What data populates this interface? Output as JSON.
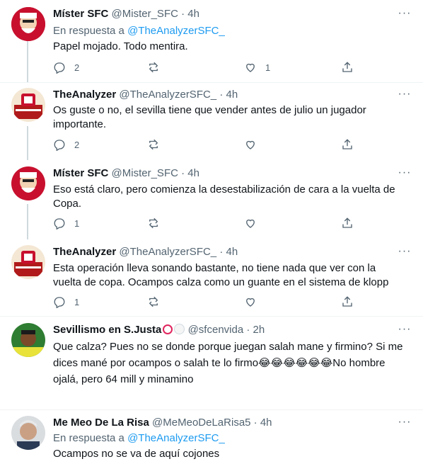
{
  "tweets": [
    {
      "name": "Míster SFC",
      "handle": "@Mister_SFC",
      "time": "4h",
      "reply_prefix": "En respuesta a",
      "reply_to": "@TheAnalyzerSFC_",
      "text": "Papel mojado. Todo mentira.",
      "replies": "2",
      "retweets": "",
      "likes": "1",
      "avatar_color": "#c8102e"
    },
    {
      "name": "TheAnalyzer",
      "handle": "@TheAnalyzerSFC_",
      "time": "4h",
      "text": "Os guste o no, el sevilla tiene que vender antes de julio un jugador importante.",
      "replies": "2",
      "retweets": "",
      "likes": "",
      "avatar_color": "#b01a1a"
    },
    {
      "name": "Míster SFC",
      "handle": "@Mister_SFC",
      "time": "4h",
      "text": "Eso está claro, pero comienza la desestabilización de cara a la vuelta de Copa.",
      "replies": "1",
      "retweets": "",
      "likes": ""
    },
    {
      "name": "TheAnalyzer",
      "handle": "@TheAnalyzerSFC_",
      "time": "4h",
      "text": "Esta operación lleva sonando bastante, no tiene nada que ver con la vuelta de copa. Ocampos calza como un guante en el sistema de klopp",
      "replies": "1",
      "retweets": "",
      "likes": ""
    },
    {
      "name": "Sevillismo en S.Justa",
      "handle": "@sfcenvida",
      "time": "2h",
      "text_line1": "Que calza? Pues no se donde porque juegan salah mane y firmino? Si me",
      "text_line2": "dices mané por ocampos o salah te lo firmo😂😂😂😂😂😂No hombre",
      "text_line3": "ojalá, pero 64 mill y minamino",
      "replies": "",
      "retweets": "",
      "likes": ""
    },
    {
      "name": "Me Meo De La Risa",
      "handle": "@MeMeoDeLaRisa5",
      "time": "4h",
      "reply_prefix": "En respuesta a",
      "reply_to": "@TheAnalyzerSFC_",
      "text": "Ocampos no se va de aquí cojones"
    }
  ],
  "dot": "·",
  "more_glyph": "···"
}
